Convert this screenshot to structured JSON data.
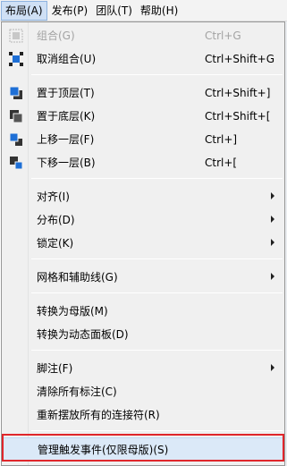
{
  "menubar": {
    "items": [
      {
        "label": "布局(A)"
      },
      {
        "label": "发布(P)"
      },
      {
        "label": "团队(T)"
      },
      {
        "label": "帮助(H)"
      }
    ]
  },
  "menu": {
    "group": {
      "label": "组合(G)",
      "shortcut": "Ctrl+G",
      "enabled": false
    },
    "ungroup": {
      "label": "取消组合(U)",
      "shortcut": "Ctrl+Shift+G"
    },
    "bring_to_front": {
      "label": "置于顶层(T)",
      "shortcut": "Ctrl+Shift+]"
    },
    "send_to_back": {
      "label": "置于底层(K)",
      "shortcut": "Ctrl+Shift+["
    },
    "bring_forward": {
      "label": "上移一层(F)",
      "shortcut": "Ctrl+]"
    },
    "send_backward": {
      "label": "下移一层(B)",
      "shortcut": "Ctrl+["
    },
    "align": {
      "label": "对齐(I)"
    },
    "distribute": {
      "label": "分布(D)"
    },
    "lock": {
      "label": "锁定(K)"
    },
    "grid_guides": {
      "label": "网格和辅助线(G)"
    },
    "convert_master": {
      "label": "转换为母版(M)"
    },
    "convert_dynamic_panel": {
      "label": "转换为动态面板(D)"
    },
    "footnotes": {
      "label": "脚注(F)"
    },
    "clear_annotations": {
      "label": "清除所有标注(C)"
    },
    "reroute_connectors": {
      "label": "重新摆放所有的连接符(R)"
    },
    "manage_raised_events": {
      "label": "管理触发事件(仅限母版)(S)"
    }
  },
  "colors": {
    "highlight_box": "#e0262b",
    "icon_blue": "#1e6fd6",
    "icon_dark": "#333333"
  }
}
